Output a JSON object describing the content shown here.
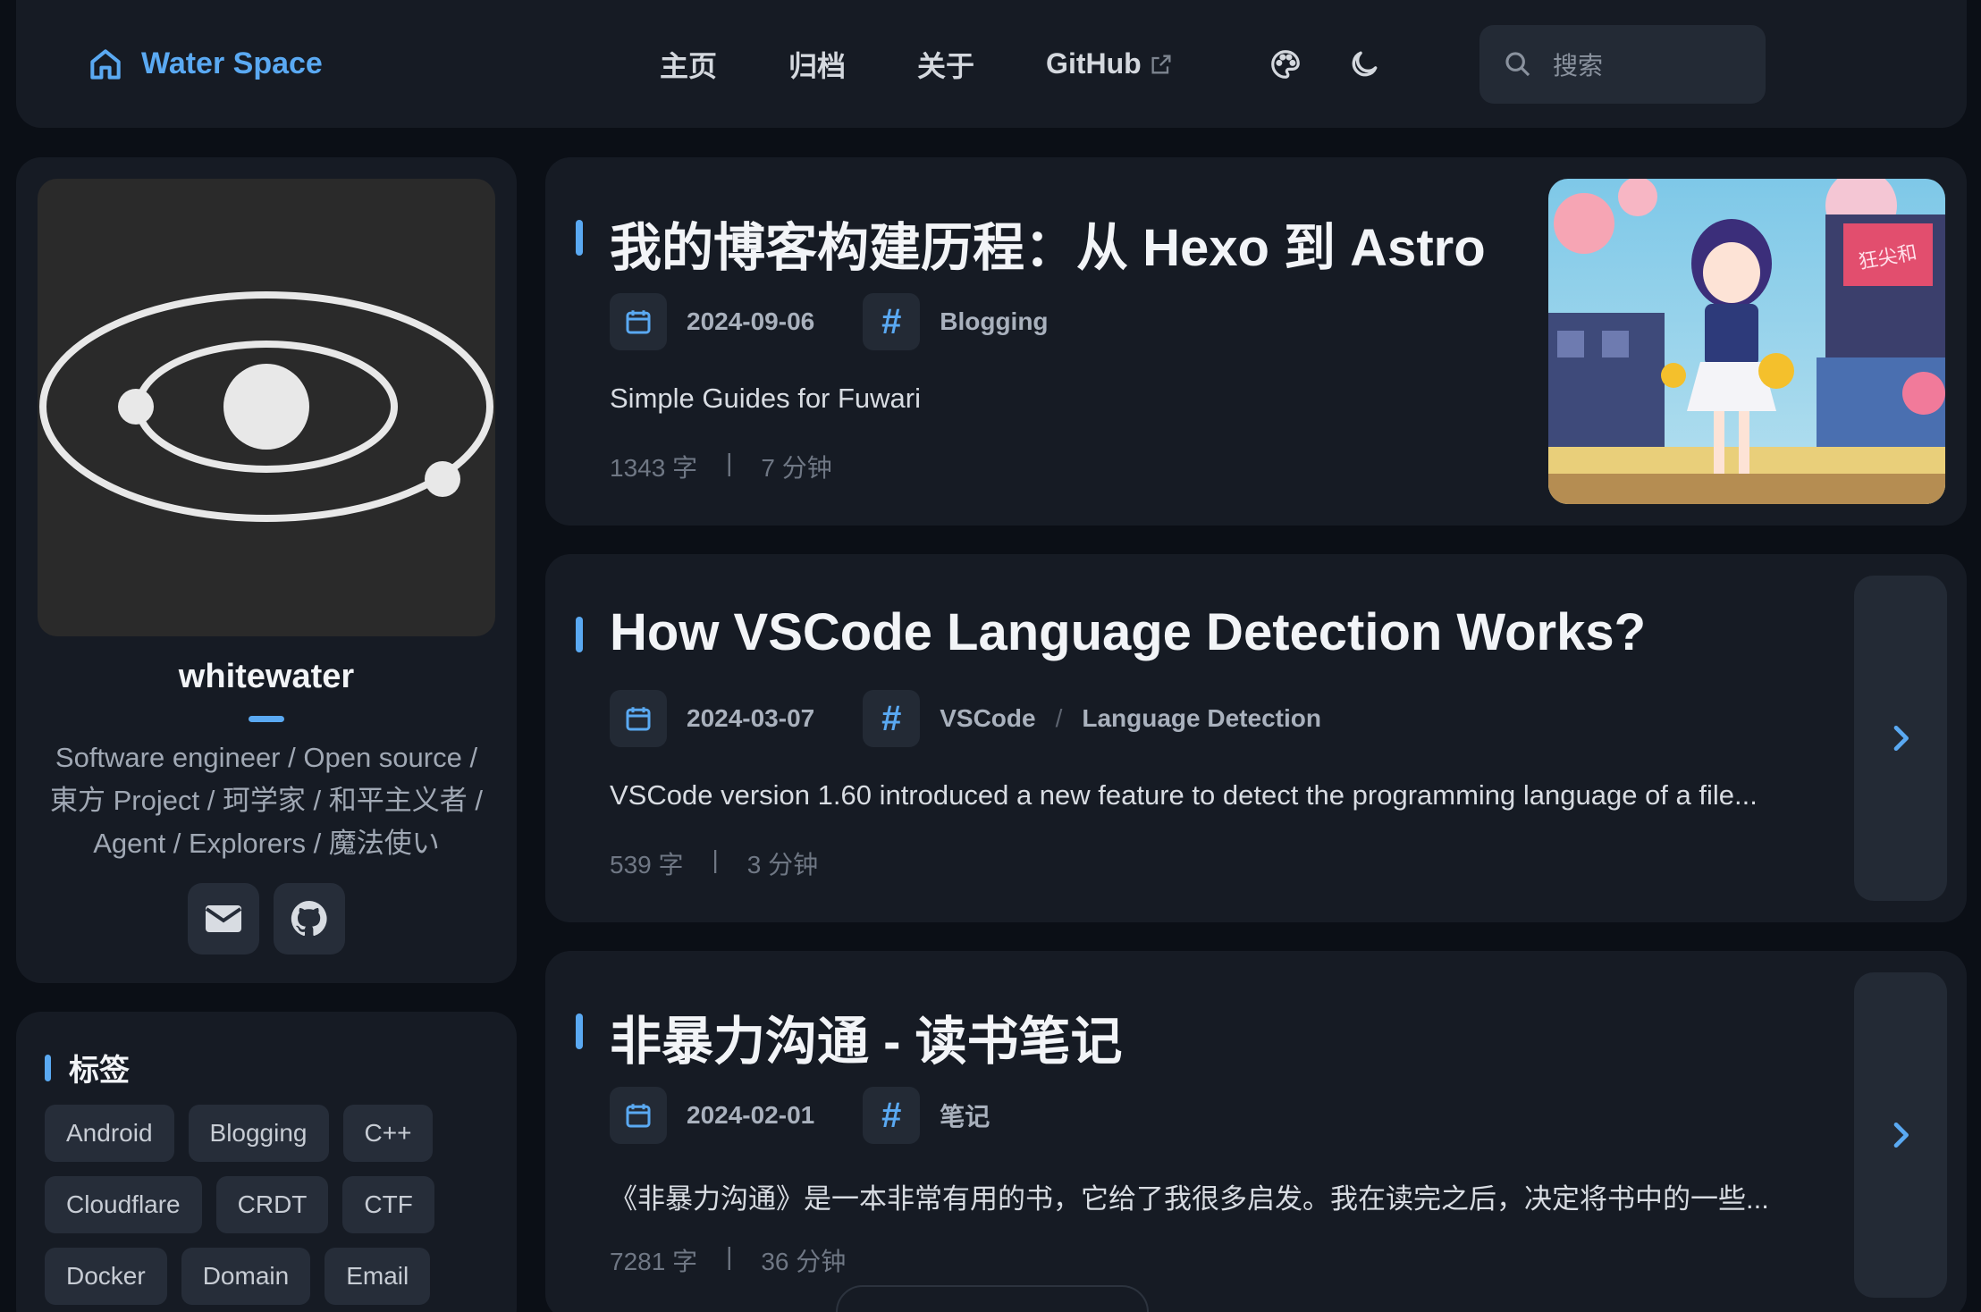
{
  "nav": {
    "brand": "Water Space",
    "links": [
      {
        "label": "主页"
      },
      {
        "label": "归档"
      },
      {
        "label": "关于"
      },
      {
        "label": "GitHub"
      }
    ],
    "search_placeholder": "搜索"
  },
  "profile": {
    "name": "whitewater",
    "bio": "Software engineer / Open source / 東方 Project / 珂学家 / 和平主义者 / Agent / Explorers / 魔法使い"
  },
  "tags": {
    "title": "标签",
    "items": [
      "Android",
      "Blogging",
      "C++",
      "Cloudflare",
      "CRDT",
      "CTF",
      "Docker",
      "Domain",
      "Email"
    ]
  },
  "posts": [
    {
      "title": "我的博客构建历程：从 Hexo 到 Astro",
      "date": "2024-09-06",
      "tags": [
        "Blogging"
      ],
      "description": "Simple Guides for Fuwari",
      "words": "1343 字",
      "read_time": "7 分钟",
      "cover_text": "狂尖和"
    },
    {
      "title": "How VSCode Language Detection Works?",
      "date": "2024-03-07",
      "tags": [
        "VSCode",
        "Language Detection"
      ],
      "description": "VSCode version 1.60 introduced a new feature to detect the programming language of a file...",
      "words": "539 字",
      "read_time": "3 分钟"
    },
    {
      "title": "非暴力沟通 - 读书笔记",
      "date": "2024-02-01",
      "tags": [
        "笔记"
      ],
      "description": "《非暴力沟通》是一本非常有用的书，它给了我很多启发。我在读完之后，决定将书中的一些...",
      "words": "7281 字",
      "read_time": "36 分钟"
    }
  ],
  "stats_separator": "|",
  "tag_separator": "/",
  "colors": {
    "accent": "#5aa9f2",
    "card": "#161b24",
    "background": "#0b0f16"
  }
}
